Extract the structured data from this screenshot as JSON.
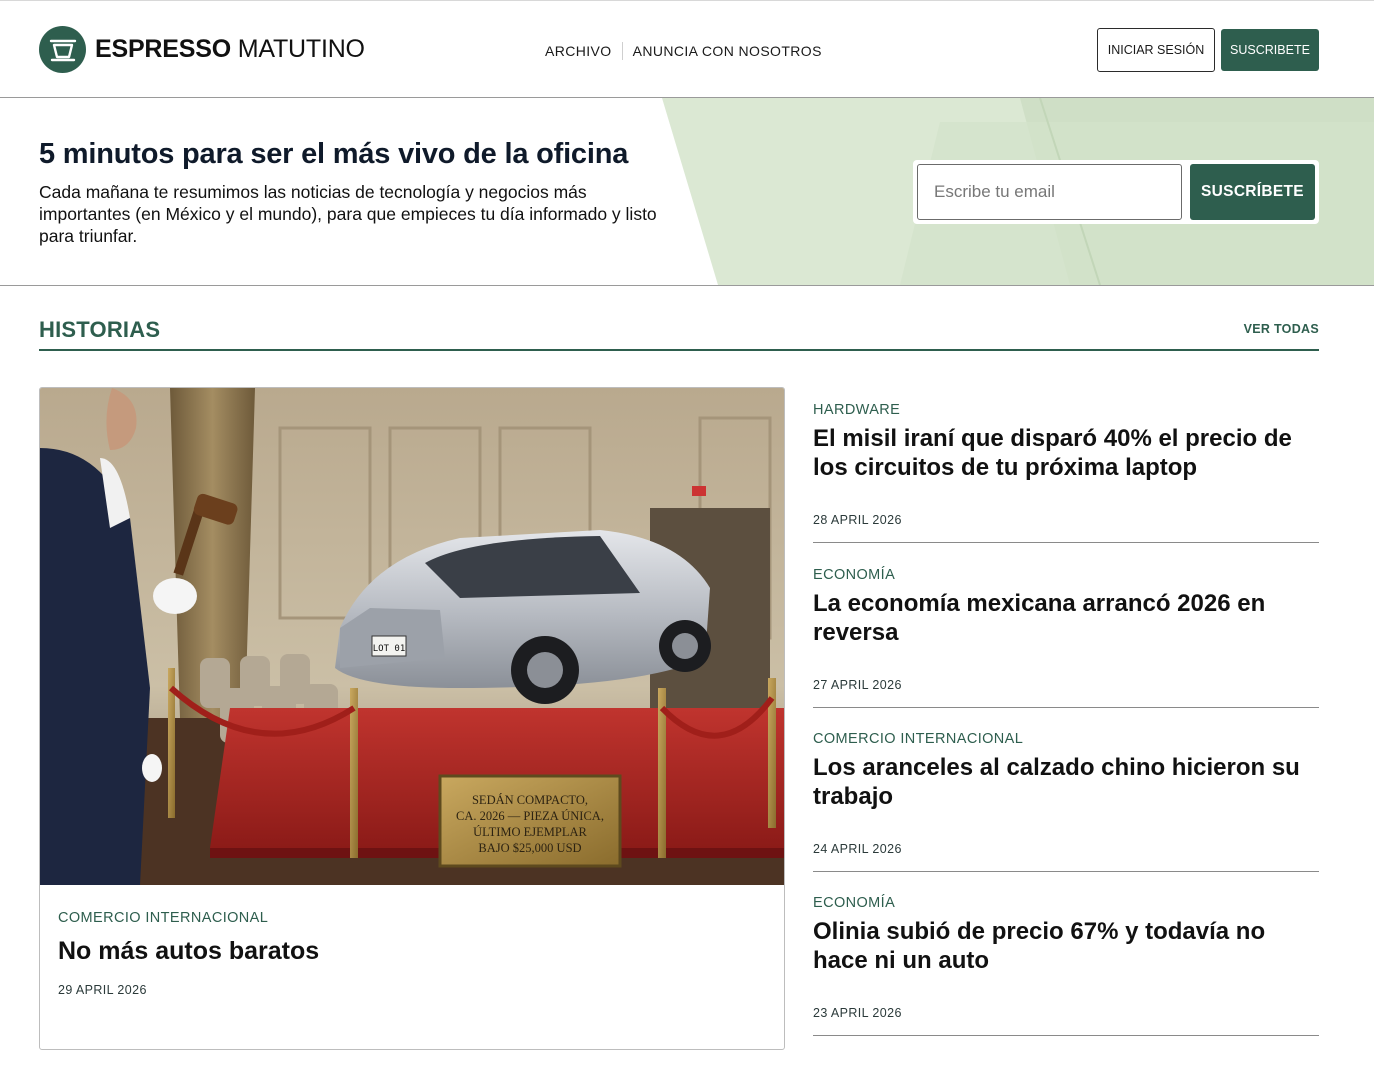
{
  "brand": {
    "name_bold": "ESPRESSO",
    "name_light": "MATUTINO",
    "color": "#2e5e4e"
  },
  "nav": {
    "items": [
      "ARCHIVO",
      "ANUNCIA CON NOSOTROS"
    ]
  },
  "header_actions": {
    "login": "INICIAR SESIÓN",
    "subscribe": "SUSCRIBETE"
  },
  "hero": {
    "title": "5 minutos para ser el más vivo de la oficina",
    "description": "Cada mañana te resumimos las noticias de tecnología y negocios más importantes (en México y el mundo), para que empieces tu día informado y listo para triunfar.",
    "email_placeholder": "Escribe tu email",
    "button": "SUSCRÍBETE"
  },
  "stories_section": {
    "title": "HISTORIAS",
    "see_all": "VER TODAS"
  },
  "featured": {
    "category": "COMERCIO INTERNACIONAL",
    "title": "No más autos baratos",
    "date": "29 APRIL 2026",
    "image": {
      "plate": "LOT 01",
      "sign_lines": [
        "SEDÁN COMPACTO,",
        "CA. 2026 — PIEZA ÚNICA,",
        "ÚLTIMO EJEMPLAR",
        "BAJO $25,000 USD"
      ]
    }
  },
  "stories": [
    {
      "category": "HARDWARE",
      "title": "El misil iraní que disparó 40% el precio de los circuitos de tu próxima laptop",
      "date": "28 APRIL 2026"
    },
    {
      "category": "ECONOMÍA",
      "title": "La economía mexicana arrancó 2026 en reversa",
      "date": "27 APRIL 2026"
    },
    {
      "category": "COMERCIO INTERNACIONAL",
      "title": "Los aranceles al calzado chino hicieron su trabajo",
      "date": "24 APRIL 2026"
    },
    {
      "category": "ECONOMÍA",
      "title": "Olinia subió de precio 67% y todavía no hace ni un auto",
      "date": "23 APRIL 2026"
    }
  ]
}
